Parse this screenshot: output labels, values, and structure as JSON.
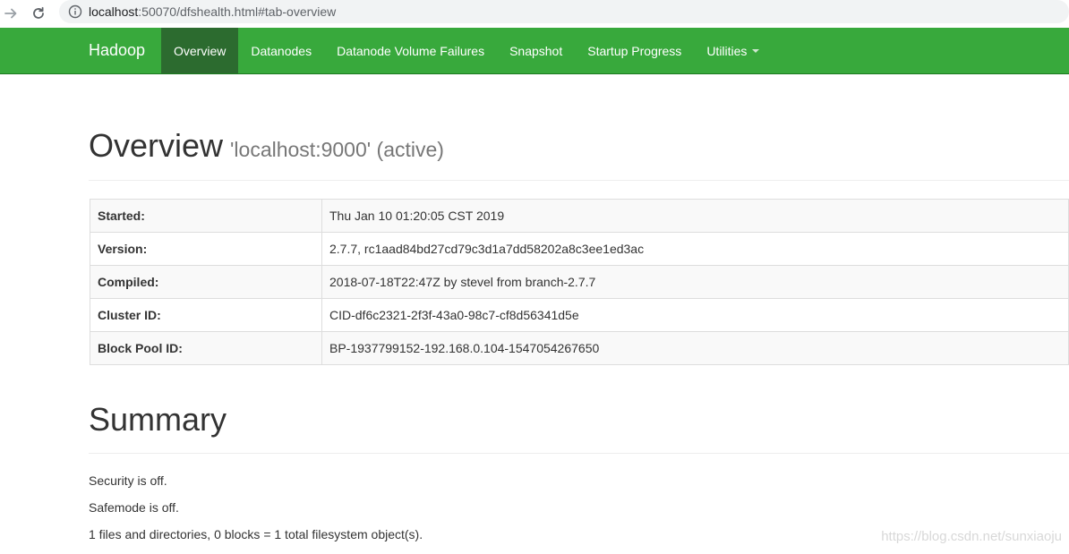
{
  "browser": {
    "url_host": "localhost",
    "url_path": ":50070/dfshealth.html#tab-overview"
  },
  "navbar": {
    "brand": "Hadoop",
    "items": [
      {
        "label": "Overview",
        "active": true
      },
      {
        "label": "Datanodes"
      },
      {
        "label": "Datanode Volume Failures"
      },
      {
        "label": "Snapshot"
      },
      {
        "label": "Startup Progress"
      },
      {
        "label": "Utilities",
        "dropdown": true
      }
    ]
  },
  "overview": {
    "title": "Overview",
    "subtitle": "'localhost:9000' (active)",
    "rows": [
      {
        "key": "Started:",
        "value": "Thu Jan 10 01:20:05 CST 2019"
      },
      {
        "key": "Version:",
        "value": "2.7.7, rc1aad84bd27cd79c3d1a7dd58202a8c3ee1ed3ac"
      },
      {
        "key": "Compiled:",
        "value": "2018-07-18T22:47Z by stevel from branch-2.7.7"
      },
      {
        "key": "Cluster ID:",
        "value": "CID-df6c2321-2f3f-43a0-98c7-cf8d56341d5e"
      },
      {
        "key": "Block Pool ID:",
        "value": "BP-1937799152-192.168.0.104-1547054267650"
      }
    ]
  },
  "summary": {
    "title": "Summary",
    "lines": [
      "Security is off.",
      "Safemode is off.",
      "1 files and directories, 0 blocks = 1 total filesystem object(s)."
    ]
  },
  "watermark": "https://blog.csdn.net/sunxiaoju"
}
